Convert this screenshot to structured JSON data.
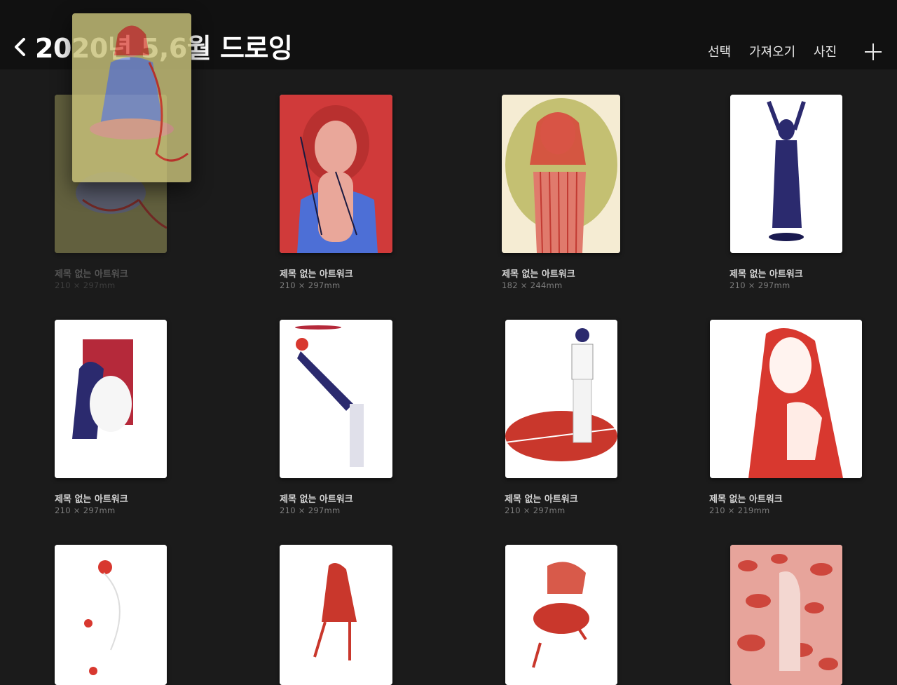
{
  "header": {
    "back_label": "2020년 5,6월 드로잉",
    "actions": {
      "select": "선택",
      "import": "가져오기",
      "photo": "사진"
    }
  },
  "artworks": [
    {
      "title": "제목 없는 아트워크",
      "size": "210 × 297mm",
      "state": "dragging"
    },
    {
      "title": "제목 없는 아트워크",
      "size": "210 × 297mm"
    },
    {
      "title": "제목 없는 아트워크",
      "size": "182 × 244mm"
    },
    {
      "title": "제목 없는 아트워크",
      "size": "210 × 297mm"
    },
    {
      "title": "제목 없는 아트워크",
      "size": "210 × 297mm"
    },
    {
      "title": "제목 없는 아트워크",
      "size": "210 × 297mm"
    },
    {
      "title": "제목 없는 아트워크",
      "size": "210 × 297mm"
    },
    {
      "title": "제목 없는 아트워크",
      "size": "210 × 219mm"
    },
    {
      "title": "",
      "size": ""
    },
    {
      "title": "",
      "size": ""
    },
    {
      "title": "",
      "size": ""
    },
    {
      "title": "",
      "size": ""
    }
  ],
  "colors": {
    "background": "#1b1b1b",
    "topbar": "#111111",
    "accent_red": "#d8382f",
    "accent_navy": "#2b2a6e",
    "olive": "#c9c27a"
  }
}
